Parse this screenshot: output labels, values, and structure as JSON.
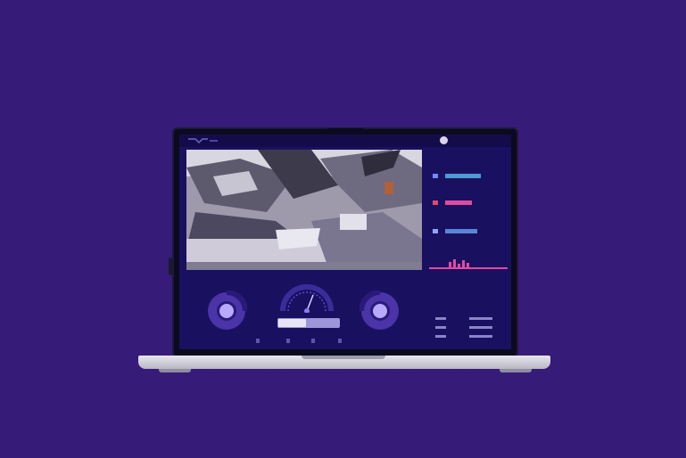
{
  "app": {
    "title": "",
    "user_name": "",
    "feed_label": ""
  },
  "panel": {
    "heading": "",
    "rows": [
      {
        "icon": "sensor-icon",
        "value": "",
        "color": "#4f9ad8"
      },
      {
        "icon": "temperature-icon",
        "value": "",
        "color": "#e04a6a"
      },
      {
        "icon": "signal-icon",
        "value": "",
        "color": "#6f8cff"
      }
    ],
    "mini_label": "",
    "telemetry_title": "",
    "telemetry_rows": [
      {
        "label": "",
        "value": ""
      },
      {
        "label": "",
        "value": ""
      },
      {
        "label": "",
        "value": ""
      }
    ]
  },
  "controls": {
    "left_joystick": "joystick-icon",
    "right_joystick": "joystick-icon",
    "status_text": "",
    "status_level": 0.45,
    "keys": [
      "",
      "",
      "",
      ""
    ]
  },
  "colors": {
    "background": "#361c78",
    "screen": "#1a1060",
    "accent": "#6b4cf0",
    "pink": "#e04aa0"
  }
}
